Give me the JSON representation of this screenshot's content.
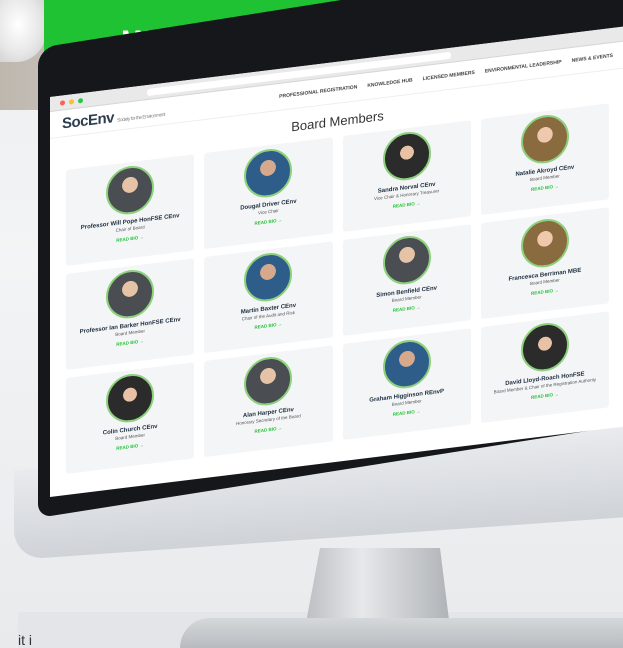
{
  "banner": {
    "cta_label": "MEET OUR TEAM >"
  },
  "site": {
    "logo": "SocEnv",
    "logo_tag": "Society for the Environment",
    "nav": [
      "PROFESSIONAL REGISTRATION",
      "KNOWLEDGE HUB",
      "LICENSED MEMBERS",
      "ENVIRONMENTAL LEADERSHIP",
      "NEWS & EVENTS"
    ]
  },
  "page": {
    "title": "Board Members",
    "read_bio": "READ BIO →"
  },
  "members": [
    {
      "name": "Professor Will Pope HonFSE CEnv",
      "role": "Chair of Board"
    },
    {
      "name": "Dougal Driver CEnv",
      "role": "Vice Chair"
    },
    {
      "name": "Sandra Norval CEnv",
      "role": "Vice Chair & Honorary Treasurer"
    },
    {
      "name": "Natalie Akroyd CEnv",
      "role": "Board Member"
    },
    {
      "name": "Professor Ian Barker HonFSE CEnv",
      "role": "Board Member"
    },
    {
      "name": "Martin Baxter CEnv",
      "role": "Chair of the Audit and Risk"
    },
    {
      "name": "Simon Benfield CEnv",
      "role": "Board Member"
    },
    {
      "name": "Francesca Berriman MBE",
      "role": "Board Member"
    },
    {
      "name": "Colin Church CEnv",
      "role": "Board Member"
    },
    {
      "name": "Alan Harper CEnv",
      "role": "Honorary Secretary of the Board"
    },
    {
      "name": "Graham Higginson REnvP",
      "role": "Board Member"
    },
    {
      "name": "David Lloyd-Roach HonFSE",
      "role": "Board Member & Chair of the Registration Authority"
    }
  ],
  "footer_text": "it i"
}
